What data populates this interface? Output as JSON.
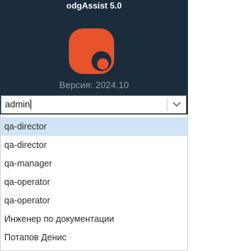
{
  "app": {
    "title": "odgAssist 5.0",
    "version_label": "Версия: 2024.10"
  },
  "login": {
    "username_value": "admin",
    "dropdown_icon": "chevron-down-icon"
  },
  "dropdown": {
    "items": [
      "qa-director",
      "qa-director",
      "qa-manager",
      "qa-operator",
      "qa-operator",
      "Инженер по документации",
      "Потапов Денис"
    ],
    "selected_index": 0
  },
  "colors": {
    "background": "#1b2d3d",
    "logo_orange": "#e8532b",
    "selected_row": "#cfe5f7"
  }
}
